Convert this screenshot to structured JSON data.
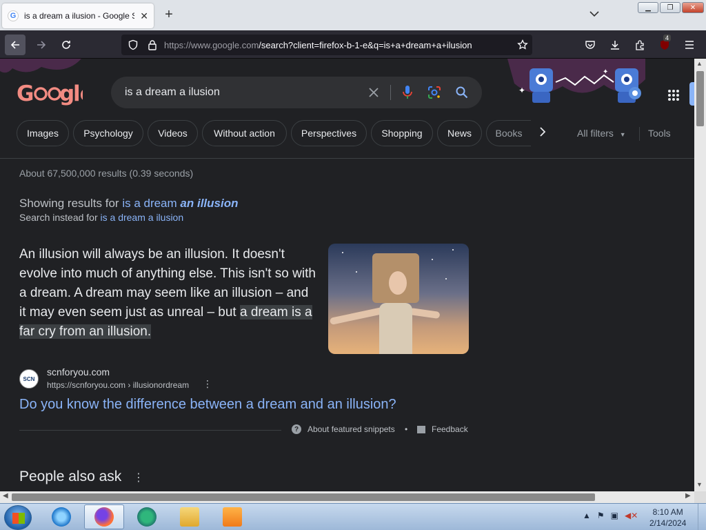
{
  "browser": {
    "tab_title": "is a dream a ilusion - Google Se",
    "new_tab": "+",
    "url_host": "https://www.google.com",
    "url_rest": "/search?client=firefox-b-1-e&q=is+a+dream+a+ilusion",
    "extension_badge": "4"
  },
  "search": {
    "logo": "Google",
    "query": "is a dream a ilusion"
  },
  "chips": [
    "Images",
    "Psychology",
    "Videos",
    "Without action",
    "Perspectives",
    "Shopping",
    "News",
    "Books"
  ],
  "filters": {
    "all_filters": "All filters",
    "tools": "Tools"
  },
  "results": {
    "stats": "About 67,500,000 results (0.39 seconds)",
    "showing_prefix": "Showing results for",
    "showing_query_plain": "is a dream",
    "showing_query_bold": "an illusion",
    "instead_prefix": "Search instead for",
    "instead_query": "is a dream a ilusion"
  },
  "snippet": {
    "text": "An illusion will always be an illusion. It doesn't evolve into much of anything else. This isn't so with a dream. A dream may seem like an illusion – and it may even seem just as unreal – but ",
    "highlight": "a dream is a far cry from an illusion.",
    "source_logo": "SCN",
    "source_name": "scnforyou.com",
    "source_url": "https://scnforyou.com › illusionordream",
    "link_title": "Do you know the difference between a dream and an illusion?",
    "about": "About featured snippets",
    "feedback": "Feedback"
  },
  "people_also_ask": "People also ask",
  "taskbar": {
    "time": "8:10 AM",
    "date": "2/14/2024"
  },
  "colors": {
    "background": "#202124",
    "link": "#8ab4f8",
    "text": "#e8eaed",
    "toolbar": "#2b2a33"
  }
}
